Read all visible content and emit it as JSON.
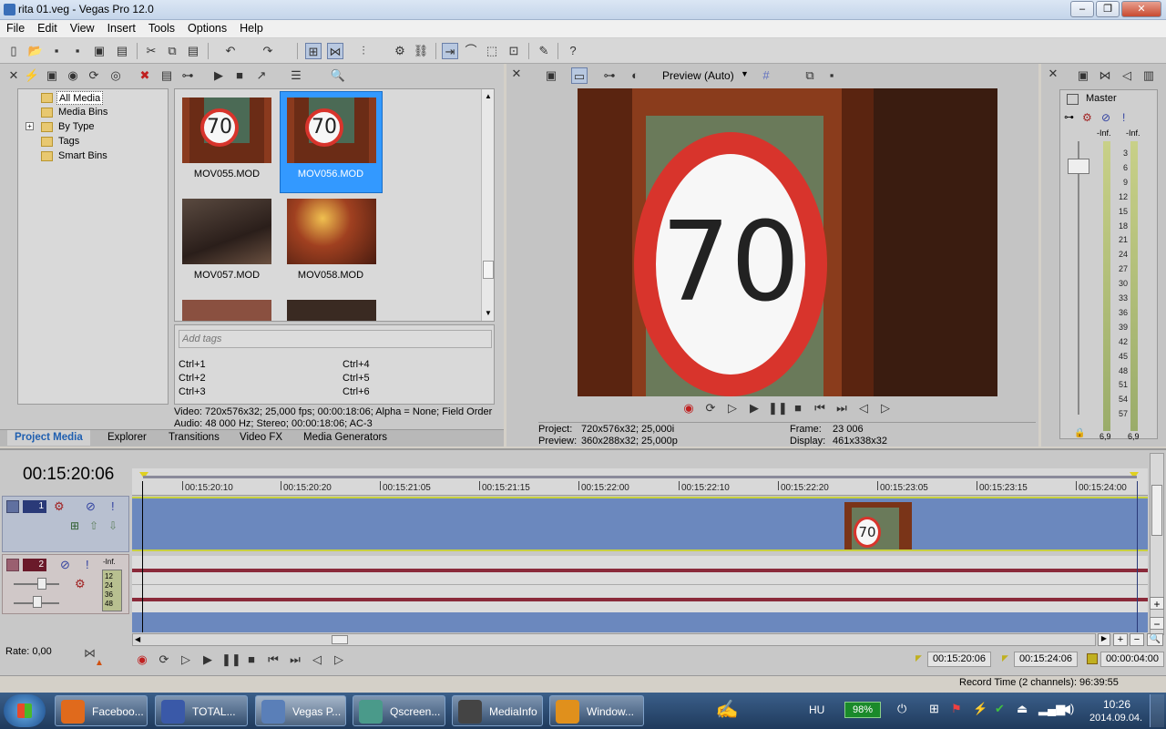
{
  "window": {
    "title": "rita 01.veg - Vegas Pro 12.0"
  },
  "menu": [
    "File",
    "Edit",
    "View",
    "Insert",
    "Tools",
    "Options",
    "Help"
  ],
  "explorer": {
    "tree": [
      "All Media",
      "Media Bins",
      "By Type",
      "Tags",
      "Smart Bins"
    ],
    "thumbs": [
      {
        "label": "MOV055.MOD"
      },
      {
        "label": "MOV056.MOD"
      },
      {
        "label": "MOV057.MOD"
      },
      {
        "label": "MOV058.MOD"
      }
    ],
    "sign_text": "70",
    "tags_placeholder": "Add tags",
    "shortcuts": [
      "Ctrl+1",
      "Ctrl+2",
      "Ctrl+3",
      "Ctrl+4",
      "Ctrl+5",
      "Ctrl+6"
    ],
    "info_video": "Video: 720x576x32; 25,000 fps; 00:00:18:06; Alpha = None; Field Order",
    "info_audio": "Audio: 48 000 Hz; Stereo; 00:00:18:06; AC-3",
    "tabs": [
      "Project Media",
      "Explorer",
      "Transitions",
      "Video FX",
      "Media Generators"
    ]
  },
  "preview": {
    "mode": "Preview (Auto)",
    "project_label": "Project:",
    "project_value": "720x576x32; 25,000i",
    "preview_label": "Preview:",
    "preview_value": "360x288x32; 25,000p",
    "frame_label": "Frame:",
    "frame_value": "23 006",
    "display_label": "Display:",
    "display_value": "461x338x32"
  },
  "master": {
    "title": "Master",
    "inf_left": "-Inf.",
    "inf_right": "-Inf.",
    "scale": [
      "3",
      "6",
      "9",
      "12",
      "15",
      "18",
      "21",
      "24",
      "27",
      "30",
      "33",
      "36",
      "39",
      "42",
      "45",
      "48",
      "51",
      "54",
      "57"
    ],
    "level_left": "6,9",
    "level_right": "6,9"
  },
  "timeline": {
    "timecode": "00:15:20:06",
    "ruler": [
      "00:15:20:10",
      "00:15:20:20",
      "00:15:21:05",
      "00:15:21:15",
      "00:15:22:00",
      "00:15:22:10",
      "00:15:22:20",
      "00:15:23:05",
      "00:15:23:15",
      "00:15:24:00"
    ],
    "track1_num": "1",
    "track2_num": "2",
    "track2_inf": "-Inf.",
    "track2_scale": [
      "12",
      "24",
      "36",
      "48"
    ],
    "rate": "Rate: 0,00",
    "sel_start": "00:15:20:06",
    "sel_end": "00:15:24:06",
    "sel_len": "00:00:04:00",
    "record_time": "Record Time (2 channels): 96:39:55"
  },
  "taskbar": {
    "items": [
      {
        "label": "Faceboo...",
        "color": "#e06a1c"
      },
      {
        "label": "TOTAL...",
        "color": "#3a59a8"
      },
      {
        "label": "Vegas P...",
        "color": "#5a7fb8"
      },
      {
        "label": "Qscreen...",
        "color": "#4a9a8a"
      },
      {
        "label": "MediaInfo",
        "color": "#444444"
      },
      {
        "label": "Window...",
        "color": "#e0901c"
      }
    ],
    "lang": "HU",
    "battery": "98%",
    "time": "10:26",
    "date": "2014.09.04."
  }
}
